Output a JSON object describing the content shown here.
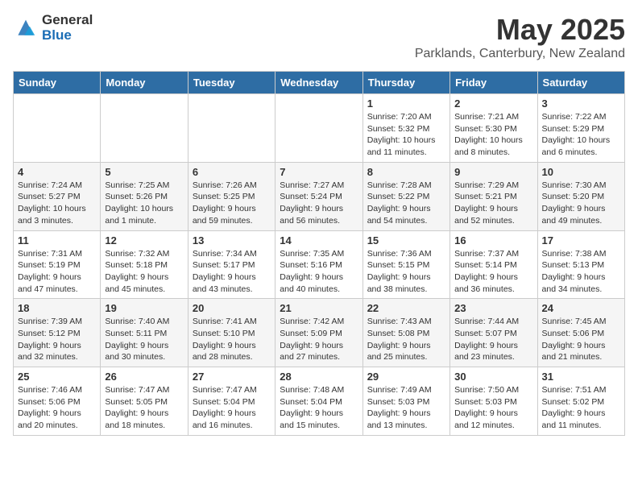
{
  "header": {
    "logo_general": "General",
    "logo_blue": "Blue",
    "title": "May 2025",
    "subtitle": "Parklands, Canterbury, New Zealand"
  },
  "calendar": {
    "columns": [
      "Sunday",
      "Monday",
      "Tuesday",
      "Wednesday",
      "Thursday",
      "Friday",
      "Saturday"
    ],
    "rows": [
      [
        {
          "day": "",
          "info": ""
        },
        {
          "day": "",
          "info": ""
        },
        {
          "day": "",
          "info": ""
        },
        {
          "day": "",
          "info": ""
        },
        {
          "day": "1",
          "info": "Sunrise: 7:20 AM\nSunset: 5:32 PM\nDaylight: 10 hours\nand 11 minutes."
        },
        {
          "day": "2",
          "info": "Sunrise: 7:21 AM\nSunset: 5:30 PM\nDaylight: 10 hours\nand 8 minutes."
        },
        {
          "day": "3",
          "info": "Sunrise: 7:22 AM\nSunset: 5:29 PM\nDaylight: 10 hours\nand 6 minutes."
        }
      ],
      [
        {
          "day": "4",
          "info": "Sunrise: 7:24 AM\nSunset: 5:27 PM\nDaylight: 10 hours\nand 3 minutes."
        },
        {
          "day": "5",
          "info": "Sunrise: 7:25 AM\nSunset: 5:26 PM\nDaylight: 10 hours\nand 1 minute."
        },
        {
          "day": "6",
          "info": "Sunrise: 7:26 AM\nSunset: 5:25 PM\nDaylight: 9 hours\nand 59 minutes."
        },
        {
          "day": "7",
          "info": "Sunrise: 7:27 AM\nSunset: 5:24 PM\nDaylight: 9 hours\nand 56 minutes."
        },
        {
          "day": "8",
          "info": "Sunrise: 7:28 AM\nSunset: 5:22 PM\nDaylight: 9 hours\nand 54 minutes."
        },
        {
          "day": "9",
          "info": "Sunrise: 7:29 AM\nSunset: 5:21 PM\nDaylight: 9 hours\nand 52 minutes."
        },
        {
          "day": "10",
          "info": "Sunrise: 7:30 AM\nSunset: 5:20 PM\nDaylight: 9 hours\nand 49 minutes."
        }
      ],
      [
        {
          "day": "11",
          "info": "Sunrise: 7:31 AM\nSunset: 5:19 PM\nDaylight: 9 hours\nand 47 minutes."
        },
        {
          "day": "12",
          "info": "Sunrise: 7:32 AM\nSunset: 5:18 PM\nDaylight: 9 hours\nand 45 minutes."
        },
        {
          "day": "13",
          "info": "Sunrise: 7:34 AM\nSunset: 5:17 PM\nDaylight: 9 hours\nand 43 minutes."
        },
        {
          "day": "14",
          "info": "Sunrise: 7:35 AM\nSunset: 5:16 PM\nDaylight: 9 hours\nand 40 minutes."
        },
        {
          "day": "15",
          "info": "Sunrise: 7:36 AM\nSunset: 5:15 PM\nDaylight: 9 hours\nand 38 minutes."
        },
        {
          "day": "16",
          "info": "Sunrise: 7:37 AM\nSunset: 5:14 PM\nDaylight: 9 hours\nand 36 minutes."
        },
        {
          "day": "17",
          "info": "Sunrise: 7:38 AM\nSunset: 5:13 PM\nDaylight: 9 hours\nand 34 minutes."
        }
      ],
      [
        {
          "day": "18",
          "info": "Sunrise: 7:39 AM\nSunset: 5:12 PM\nDaylight: 9 hours\nand 32 minutes."
        },
        {
          "day": "19",
          "info": "Sunrise: 7:40 AM\nSunset: 5:11 PM\nDaylight: 9 hours\nand 30 minutes."
        },
        {
          "day": "20",
          "info": "Sunrise: 7:41 AM\nSunset: 5:10 PM\nDaylight: 9 hours\nand 28 minutes."
        },
        {
          "day": "21",
          "info": "Sunrise: 7:42 AM\nSunset: 5:09 PM\nDaylight: 9 hours\nand 27 minutes."
        },
        {
          "day": "22",
          "info": "Sunrise: 7:43 AM\nSunset: 5:08 PM\nDaylight: 9 hours\nand 25 minutes."
        },
        {
          "day": "23",
          "info": "Sunrise: 7:44 AM\nSunset: 5:07 PM\nDaylight: 9 hours\nand 23 minutes."
        },
        {
          "day": "24",
          "info": "Sunrise: 7:45 AM\nSunset: 5:06 PM\nDaylight: 9 hours\nand 21 minutes."
        }
      ],
      [
        {
          "day": "25",
          "info": "Sunrise: 7:46 AM\nSunset: 5:06 PM\nDaylight: 9 hours\nand 20 minutes."
        },
        {
          "day": "26",
          "info": "Sunrise: 7:47 AM\nSunset: 5:05 PM\nDaylight: 9 hours\nand 18 minutes."
        },
        {
          "day": "27",
          "info": "Sunrise: 7:47 AM\nSunset: 5:04 PM\nDaylight: 9 hours\nand 16 minutes."
        },
        {
          "day": "28",
          "info": "Sunrise: 7:48 AM\nSunset: 5:04 PM\nDaylight: 9 hours\nand 15 minutes."
        },
        {
          "day": "29",
          "info": "Sunrise: 7:49 AM\nSunset: 5:03 PM\nDaylight: 9 hours\nand 13 minutes."
        },
        {
          "day": "30",
          "info": "Sunrise: 7:50 AM\nSunset: 5:03 PM\nDaylight: 9 hours\nand 12 minutes."
        },
        {
          "day": "31",
          "info": "Sunrise: 7:51 AM\nSunset: 5:02 PM\nDaylight: 9 hours\nand 11 minutes."
        }
      ]
    ]
  }
}
